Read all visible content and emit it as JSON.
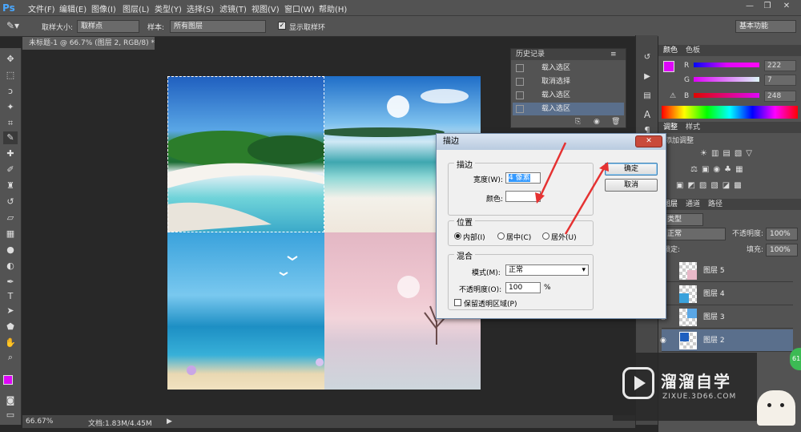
{
  "app": {
    "logo": "Ps"
  },
  "menu": [
    "文件(F)",
    "编辑(E)",
    "图像(I)",
    "图层(L)",
    "类型(Y)",
    "选择(S)",
    "滤镜(T)",
    "视图(V)",
    "窗口(W)",
    "帮助(H)"
  ],
  "window_controls": {
    "minimize": "—",
    "restore": "❐",
    "close": "✕"
  },
  "options": {
    "sample_size_label": "取样大小:",
    "sample_size_value": "取样点",
    "sample_label": "样本:",
    "sample_value": "所有图层",
    "show_ring_label": "显示取样环",
    "workspace_value": "基本功能"
  },
  "document": {
    "tab_title": "未标题-1 @ 66.7% (图层 2, RGB/8) *",
    "zoom": "66.67%",
    "doc_size": "文档:1.83M/4.45M"
  },
  "history": {
    "title": "历史记录",
    "items": [
      "载入选区",
      "取消选择",
      "载入选区",
      "载入选区"
    ]
  },
  "color_panel": {
    "tabs": [
      "颜色",
      "色板"
    ],
    "r_label": "R",
    "r_value": "222",
    "g_label": "G",
    "g_value": "7",
    "b_label": "B",
    "b_value": "248",
    "foreground": "#de07f8"
  },
  "adjustments": {
    "tabs": [
      "调整",
      "样式"
    ],
    "title": "添加调整"
  },
  "layers": {
    "tabs": [
      "图层",
      "通道",
      "路径"
    ],
    "kind_label": "类型",
    "mode_label": "正常",
    "opacity_label": "不透明度:",
    "opacity_value": "100%",
    "lock_label": "锁定:",
    "fill_label": "填充:",
    "fill_value": "100%",
    "rows": [
      "图层 5",
      "图层 4",
      "图层 3",
      "图层 2"
    ],
    "badge": "61"
  },
  "dialog": {
    "title": "描边",
    "stroke_group": "描边",
    "width_label": "宽度(W):",
    "width_value": "4 像素",
    "color_label": "颜色:",
    "position_group": "位置",
    "inside_label": "内部(I)",
    "center_label": "居中(C)",
    "outside_label": "居外(U)",
    "blend_group": "混合",
    "mode_label": "模式(M):",
    "mode_value": "正常",
    "opacity_label": "不透明度(O):",
    "opacity_value": "100",
    "opacity_unit": "%",
    "preserve_label": "保留透明区域(P)",
    "ok_label": "确定",
    "cancel_label": "取消"
  },
  "watermark": {
    "brand": "溜溜自学",
    "url": "ZIXUE.3D66.COM"
  },
  "colors": {
    "accent_arrow": "#e53232",
    "selected_layer": "#5a6f8c"
  }
}
